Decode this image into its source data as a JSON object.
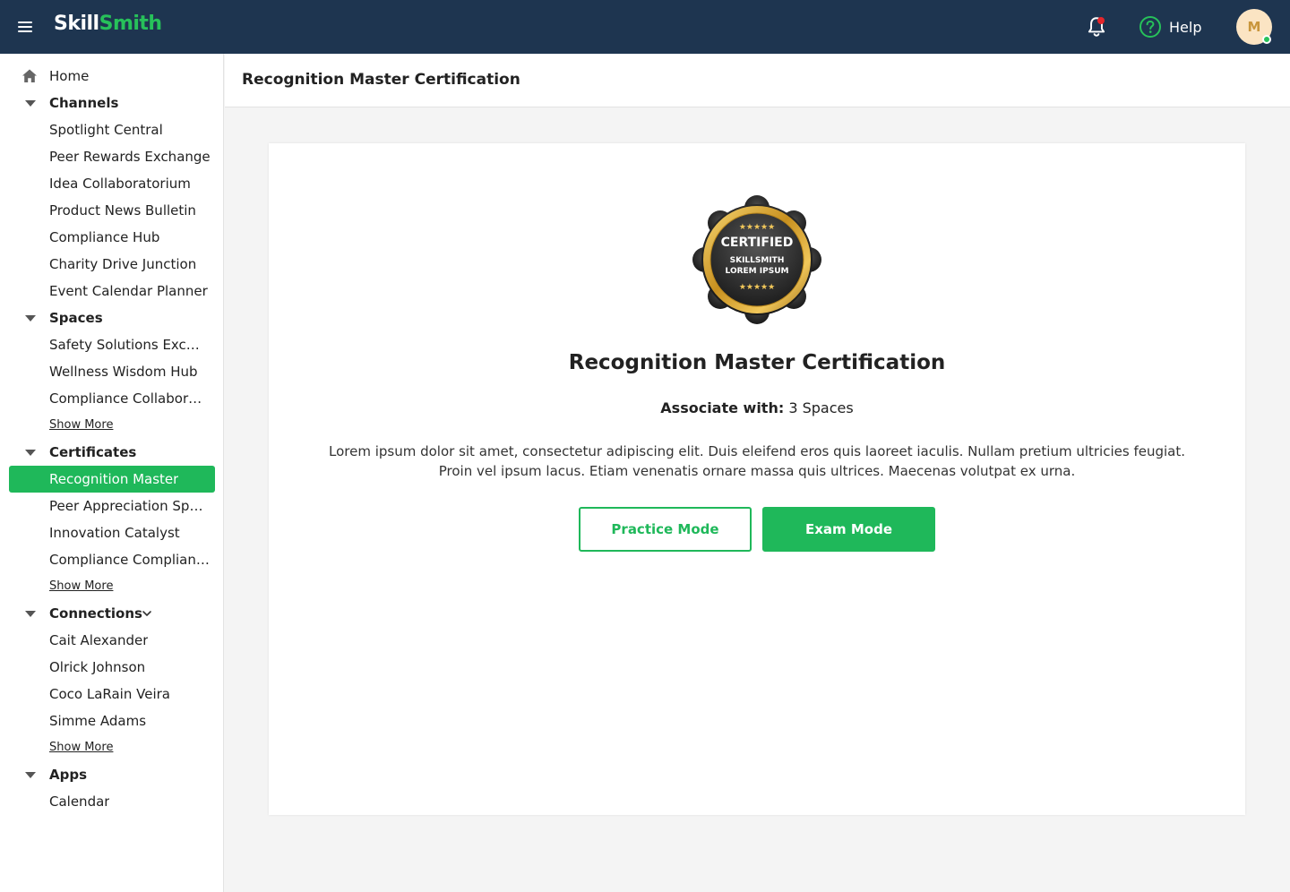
{
  "topbar": {
    "logo_part1": "Skill",
    "logo_part2": "Smith",
    "help_label": "Help",
    "avatar_initial": "M",
    "icons": [
      "menu-icon",
      "bell-icon",
      "help-circle-icon"
    ]
  },
  "sidebar": {
    "home": "Home",
    "channels": {
      "title": "Channels",
      "items": [
        "Spotlight Central",
        "Peer Rewards Exchange",
        "Idea Collaboratorium",
        "Product News Bulletin",
        "Compliance Hub",
        "Charity Drive Junction",
        "Event Calendar Planner"
      ]
    },
    "spaces": {
      "title": "Spaces",
      "items": [
        "Safety Solutions Exchange",
        "Wellness Wisdom Hub",
        "Compliance Collaboration"
      ],
      "show_more": "Show More"
    },
    "certificates": {
      "title": "Certificates",
      "items": [
        "Recognition Master",
        "Peer Appreciation Specialist",
        "Innovation Catalyst",
        "Compliance Compliance Pro"
      ],
      "show_more": "Show More",
      "active": "Recognition Master"
    },
    "connections": {
      "title": "Connections",
      "items": [
        "Cait Alexander",
        "Olrick Johnson",
        "Coco LaRain Veira",
        "Simme Adams"
      ],
      "show_more": "Show More"
    },
    "apps": {
      "title": "Apps",
      "items": [
        "Calendar"
      ]
    }
  },
  "header": {
    "title": "Recognition Master Certification"
  },
  "main": {
    "badge": {
      "line1": "CERTIFIED",
      "line2": "SKILLSMITH",
      "line3": "LOREM IPSUM",
      "stars": "★★★★★"
    },
    "title": "Recognition Master Certification",
    "associate_label": "Associate with:",
    "associate_value": "3 Spaces",
    "description": "Lorem ipsum dolor sit amet, consectetur adipiscing elit. Duis eleifend eros quis laoreet iaculis. Nullam pretium ultricies feugiat. Proin vel ipsum lacus. Etiam venenatis ornare massa quis ultrices. Maecenas volutpat ex urna.",
    "practice_button": "Practice Mode",
    "exam_button": "Exam Mode"
  },
  "colors": {
    "topbar": "#1e3550",
    "accent_green": "#1fb85a",
    "notification_dot": "#e5262b"
  }
}
